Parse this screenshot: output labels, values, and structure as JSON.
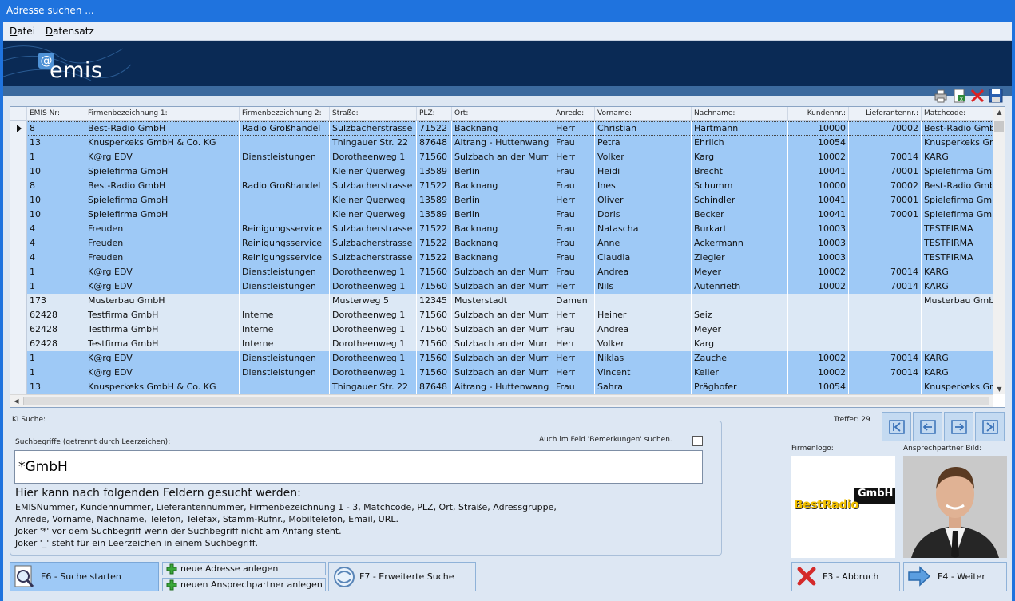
{
  "window": {
    "title": "Adresse suchen ..."
  },
  "menu": [
    {
      "label": "Datei"
    },
    {
      "label": "Datensatz"
    }
  ],
  "brand": {
    "logo_text": "emis"
  },
  "grid": {
    "columns": [
      {
        "key": "emis",
        "label": "EMIS Nr:"
      },
      {
        "key": "firm1",
        "label": "Firmenbezeichnung 1:"
      },
      {
        "key": "firm2",
        "label": "Firmenbezeichnung 2:"
      },
      {
        "key": "street",
        "label": "Straße:"
      },
      {
        "key": "plz",
        "label": "PLZ:"
      },
      {
        "key": "ort",
        "label": "Ort:"
      },
      {
        "key": "anrede",
        "label": "Anrede:"
      },
      {
        "key": "vorname",
        "label": "Vorname:"
      },
      {
        "key": "nachname",
        "label": "Nachname:"
      },
      {
        "key": "kunden",
        "label": "Kundennr.:"
      },
      {
        "key": "lieferant",
        "label": "Lieferantennr.:"
      },
      {
        "key": "match",
        "label": "Matchcode:"
      }
    ],
    "rows": [
      {
        "emis": "8",
        "firm1": "Best-Radio GmbH",
        "firm2": "Radio Großhandel",
        "street": "Sulzbacherstrasse",
        "plz": "71522",
        "ort": "Backnang",
        "anrede": "Herr",
        "vorname": "Christian",
        "nachname": "Hartmann",
        "kunden": "10000",
        "lieferant": "70002",
        "match": "Best-Radio GmbH",
        "style": "sel"
      },
      {
        "emis": "13",
        "firm1": "Knusperkeks GmbH & Co. KG",
        "firm2": "",
        "street": "Thingauer Str. 22",
        "plz": "87648",
        "ort": "Aitrang - Huttenwang",
        "anrede": "Frau",
        "vorname": "Petra",
        "nachname": "Ehrlich",
        "kunden": "10054",
        "lieferant": "",
        "match": "Knusperkeks GmbH",
        "style": "blue"
      },
      {
        "emis": "1",
        "firm1": "K@rg EDV",
        "firm2": "Dienstleistungen",
        "street": "Dorotheenweg 1",
        "plz": "71560",
        "ort": "Sulzbach an der Murr",
        "anrede": "Herr",
        "vorname": "Volker",
        "nachname": "Karg",
        "kunden": "10002",
        "lieferant": "70014",
        "match": "KARG",
        "style": "blue"
      },
      {
        "emis": "10",
        "firm1": "Spielefirma GmbH",
        "firm2": "",
        "street": "Kleiner Querweg",
        "plz": "13589",
        "ort": "Berlin",
        "anrede": "Frau",
        "vorname": "Heidi",
        "nachname": "Brecht",
        "kunden": "10041",
        "lieferant": "70001",
        "match": "Spielefirma GmbH",
        "style": "blue"
      },
      {
        "emis": "8",
        "firm1": "Best-Radio GmbH",
        "firm2": "Radio Großhandel",
        "street": "Sulzbacherstrasse",
        "plz": "71522",
        "ort": "Backnang",
        "anrede": "Frau",
        "vorname": "Ines",
        "nachname": "Schumm",
        "kunden": "10000",
        "lieferant": "70002",
        "match": "Best-Radio GmbH",
        "style": "blue"
      },
      {
        "emis": "10",
        "firm1": "Spielefirma GmbH",
        "firm2": "",
        "street": "Kleiner Querweg",
        "plz": "13589",
        "ort": "Berlin",
        "anrede": "Herr",
        "vorname": "Oliver",
        "nachname": "Schindler",
        "kunden": "10041",
        "lieferant": "70001",
        "match": "Spielefirma GmbH",
        "style": "blue"
      },
      {
        "emis": "10",
        "firm1": "Spielefirma GmbH",
        "firm2": "",
        "street": "Kleiner Querweg",
        "plz": "13589",
        "ort": "Berlin",
        "anrede": "Frau",
        "vorname": "Doris",
        "nachname": "Becker",
        "kunden": "10041",
        "lieferant": "70001",
        "match": "Spielefirma GmbH",
        "style": "blue"
      },
      {
        "emis": "4",
        "firm1": "Freuden",
        "firm2": "Reinigungsservice",
        "street": "Sulzbacherstrasse",
        "plz": "71522",
        "ort": "Backnang",
        "anrede": "Frau",
        "vorname": "Natascha",
        "nachname": "Burkart",
        "kunden": "10003",
        "lieferant": "",
        "match": "TESTFIRMA",
        "style": "blue"
      },
      {
        "emis": "4",
        "firm1": "Freuden",
        "firm2": "Reinigungsservice",
        "street": "Sulzbacherstrasse",
        "plz": "71522",
        "ort": "Backnang",
        "anrede": "Frau",
        "vorname": "Anne",
        "nachname": "Ackermann",
        "kunden": "10003",
        "lieferant": "",
        "match": "TESTFIRMA",
        "style": "blue"
      },
      {
        "emis": "4",
        "firm1": "Freuden",
        "firm2": "Reinigungsservice",
        "street": "Sulzbacherstrasse",
        "plz": "71522",
        "ort": "Backnang",
        "anrede": "Frau",
        "vorname": "Claudia",
        "nachname": "Ziegler",
        "kunden": "10003",
        "lieferant": "",
        "match": "TESTFIRMA",
        "style": "blue"
      },
      {
        "emis": "1",
        "firm1": "K@rg EDV",
        "firm2": "Dienstleistungen",
        "street": "Dorotheenweg 1",
        "plz": "71560",
        "ort": "Sulzbach an der Murr",
        "anrede": "Frau",
        "vorname": "Andrea",
        "nachname": "Meyer",
        "kunden": "10002",
        "lieferant": "70014",
        "match": "KARG",
        "style": "blue"
      },
      {
        "emis": "1",
        "firm1": "K@rg EDV",
        "firm2": "Dienstleistungen",
        "street": "Dorotheenweg 1",
        "plz": "71560",
        "ort": "Sulzbach an der Murr",
        "anrede": "Herr",
        "vorname": "Nils",
        "nachname": "Autenrieth",
        "kunden": "10002",
        "lieferant": "70014",
        "match": "KARG",
        "style": "blue"
      },
      {
        "emis": "173",
        "firm1": "Musterbau GmbH",
        "firm2": "",
        "street": "Musterweg 5",
        "plz": "12345",
        "ort": "Musterstadt",
        "anrede": "Damen",
        "vorname": "",
        "nachname": "",
        "kunden": "",
        "lieferant": "",
        "match": "Musterbau GmbH",
        "style": "light"
      },
      {
        "emis": "62428",
        "firm1": "Testfirma GmbH",
        "firm2": "Interne",
        "street": "Dorotheenweg 1",
        "plz": "71560",
        "ort": "Sulzbach an der Murr",
        "anrede": "Herr",
        "vorname": "Heiner",
        "nachname": "Seiz",
        "kunden": "",
        "lieferant": "",
        "match": "",
        "style": "light"
      },
      {
        "emis": "62428",
        "firm1": "Testfirma GmbH",
        "firm2": "Interne",
        "street": "Dorotheenweg 1",
        "plz": "71560",
        "ort": "Sulzbach an der Murr",
        "anrede": "Frau",
        "vorname": "Andrea",
        "nachname": "Meyer",
        "kunden": "",
        "lieferant": "",
        "match": "",
        "style": "light"
      },
      {
        "emis": "62428",
        "firm1": "Testfirma GmbH",
        "firm2": "Interne",
        "street": "Dorotheenweg 1",
        "plz": "71560",
        "ort": "Sulzbach an der Murr",
        "anrede": "Herr",
        "vorname": "Volker",
        "nachname": "Karg",
        "kunden": "",
        "lieferant": "",
        "match": "",
        "style": "light"
      },
      {
        "emis": "1",
        "firm1": "K@rg EDV",
        "firm2": "Dienstleistungen",
        "street": "Dorotheenweg 1",
        "plz": "71560",
        "ort": "Sulzbach an der Murr",
        "anrede": "Herr",
        "vorname": "Niklas",
        "nachname": "Zauche",
        "kunden": "10002",
        "lieferant": "70014",
        "match": "KARG",
        "style": "blue"
      },
      {
        "emis": "1",
        "firm1": "K@rg EDV",
        "firm2": "Dienstleistungen",
        "street": "Dorotheenweg 1",
        "plz": "71560",
        "ort": "Sulzbach an der Murr",
        "anrede": "Herr",
        "vorname": "Vincent",
        "nachname": "Keller",
        "kunden": "10002",
        "lieferant": "70014",
        "match": "KARG",
        "style": "blue"
      },
      {
        "emis": "13",
        "firm1": "Knusperkeks GmbH & Co. KG",
        "firm2": "",
        "street": "Thingauer Str. 22",
        "plz": "87648",
        "ort": "Aitrang - Huttenwang",
        "anrede": "Frau",
        "vorname": "Sahra",
        "nachname": "Präghofer",
        "kunden": "10054",
        "lieferant": "",
        "match": "Knusperkeks GmbH",
        "style": "blue"
      }
    ]
  },
  "search": {
    "group_label": "KI Suche:",
    "field_label": "Suchbegriffe (getrennt durch Leerzeichen):",
    "value": "*GmbH",
    "remarks_label": "Auch im Feld 'Bemerkungen' suchen.",
    "help_title": "Hier kann nach folgenden Feldern gesucht werden:",
    "help_lines": [
      "EMISNummer, Kundennummer, Lieferantennummer, Firmenbezeichnung 1 - 3, Matchcode, PLZ, Ort, Straße, Adressgruppe,",
      "Anrede, Vorname, Nachname, Telefon, Telefax, Stamm-Rufnr., Mobiltelefon, Email, URL.",
      "Joker '*' vor dem Suchbegriff wenn der Suchbegriff nicht am Anfang steht.",
      "Joker '_' steht für ein Leerzeichen in einem Suchbegriff."
    ]
  },
  "results": {
    "count_label": "Treffer: 29"
  },
  "panels": {
    "firmenlogo_label": "Firmenlogo:",
    "ap_label": "Ansprechpartner Bild:",
    "logo_word1": "BestRadio",
    "logo_word2": "GmbH"
  },
  "buttons": {
    "search_start": "F6 - Suche starten",
    "new_address": "neue Adresse anlegen",
    "new_contact": "neuen Ansprechpartner anlegen",
    "extended_search": "F7 - Erweiterte Suche",
    "cancel": "F3 - Abbruch",
    "next": "F4 - Weiter"
  },
  "colors": {
    "title_bar": "#1f73de",
    "banner": "#0a2a55",
    "row_blue": "#9ec9f6",
    "row_light": "#dce8f5"
  }
}
